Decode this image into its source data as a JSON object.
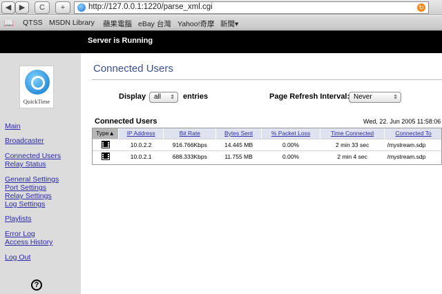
{
  "browser": {
    "url": "http://127.0.0.1:1220/parse_xml.cgi",
    "back_glyph": "◀",
    "forward_glyph": "▶",
    "reload_glyph": "C",
    "add_glyph": "+",
    "bookmarks": [
      "QTSS",
      "MSDN Library",
      "蘋果電腦",
      "eBay 台灣",
      "Yahoo!奇摩",
      "新聞▾"
    ]
  },
  "banner": {
    "status": "Server is Running"
  },
  "sidebar": {
    "logo_text": "QuickTime",
    "links": [
      "Main",
      "Broadcaster",
      "Connected Users",
      "Relay Status",
      "General Settings",
      "Port Settings",
      "Relay Settings",
      "Log Settings",
      "Playlists",
      "Error Log",
      "Access History",
      "Log Out"
    ],
    "help_glyph": "?"
  },
  "main": {
    "heading": "Connected Users",
    "display_label": "Display",
    "display_value": "all",
    "entries_label": "entries",
    "refresh_label": "Page Refresh Interval:",
    "refresh_value": "Never",
    "table_title": "Connected Users",
    "datetime": "Wed, 22. Jun 2005 11:58:06",
    "columns": [
      "Type▲",
      "IP Address",
      "Bit Rate",
      "Bytes Sent",
      "% Packet Loss",
      "Time Connected",
      "Connected To"
    ],
    "rows": [
      [
        "film-icon",
        "10.0.2.2",
        "916.766Kbps",
        "14.445 MB",
        "0.00%",
        "2 min 33 sec",
        "/mystream.sdp"
      ],
      [
        "film-icon",
        "10.0.2.1",
        "688.333Kbps",
        "11.755 MB",
        "0.00%",
        "2 min 4 sec",
        "/mystream.sdp"
      ]
    ]
  }
}
